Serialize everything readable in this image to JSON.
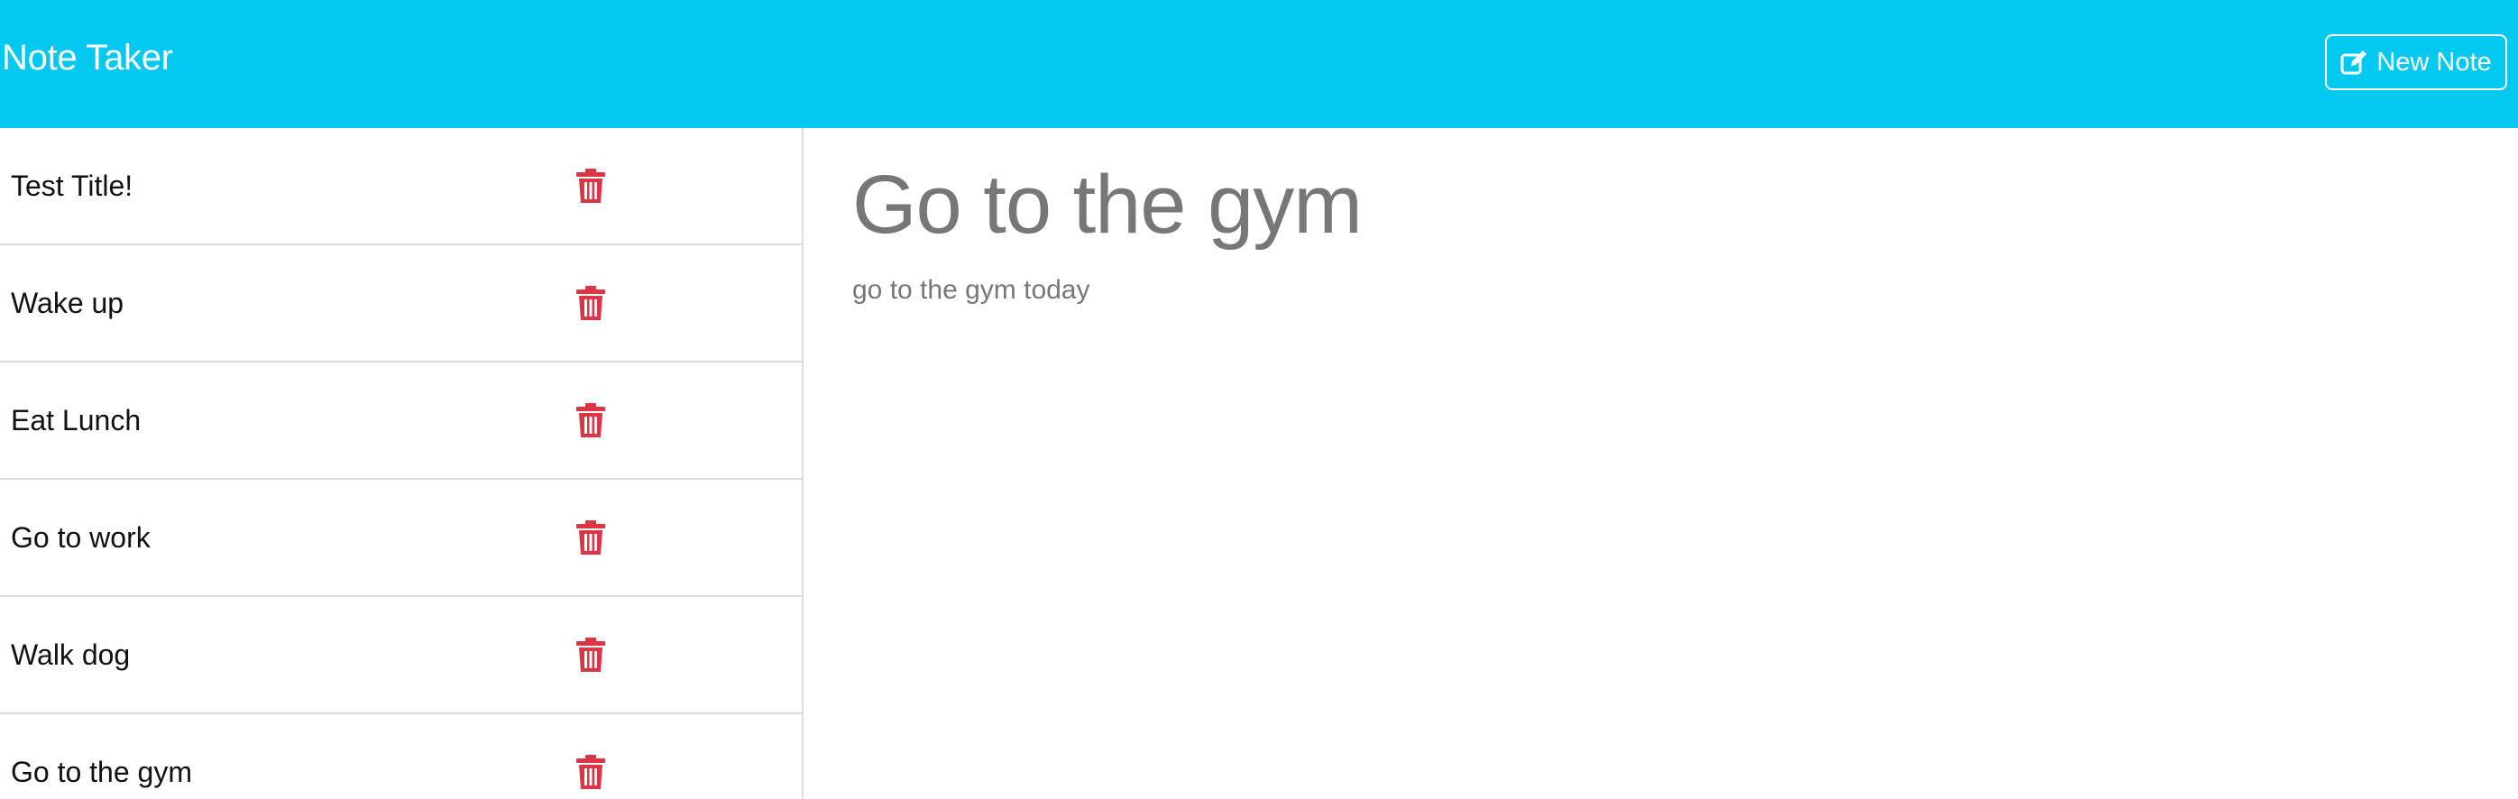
{
  "header": {
    "brand": "Note Taker",
    "new_note_label": "New Note",
    "new_note_icon": "edit-icon",
    "bg_color": "#03c8f0"
  },
  "sidebar": {
    "items": [
      {
        "title": "Test Title!"
      },
      {
        "title": "Wake up"
      },
      {
        "title": "Eat Lunch"
      },
      {
        "title": "Go to work"
      },
      {
        "title": "Walk dog"
      },
      {
        "title": "Go to the gym"
      }
    ],
    "delete_icon": "trash-icon",
    "delete_color": "#dc3545"
  },
  "editor": {
    "title": "Go to the gym",
    "body": "go to the gym today"
  }
}
